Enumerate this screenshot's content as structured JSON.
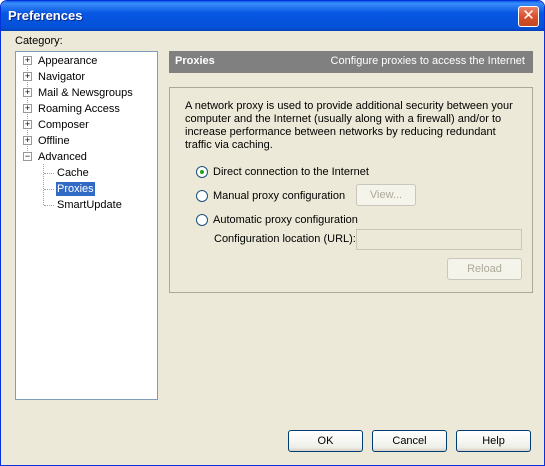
{
  "window": {
    "title": "Preferences"
  },
  "sidebar": {
    "label": "Category:",
    "items": [
      {
        "label": "Appearance",
        "expander": "+"
      },
      {
        "label": "Navigator",
        "expander": "+"
      },
      {
        "label": "Mail & Newsgroups",
        "expander": "+"
      },
      {
        "label": "Roaming Access",
        "expander": "+"
      },
      {
        "label": "Composer",
        "expander": "+"
      },
      {
        "label": "Offline",
        "expander": "+"
      },
      {
        "label": "Advanced",
        "expander": "−"
      },
      {
        "label": "Cache"
      },
      {
        "label": "Proxies",
        "selected": true
      },
      {
        "label": "SmartUpdate"
      }
    ]
  },
  "header": {
    "title": "Proxies",
    "description": "Configure proxies to access the Internet"
  },
  "panel": {
    "description": "A network proxy is used to provide additional security between your computer and the Internet (usually along with a firewall) and/or to increase performance between networks by reducing redundant traffic via caching.",
    "options": {
      "direct": {
        "label": "Direct connection to the Internet",
        "checked": true
      },
      "manual": {
        "label": "Manual proxy configuration",
        "checked": false
      },
      "auto": {
        "label": "Automatic proxy configuration",
        "checked": false
      }
    },
    "view_button": "View...",
    "url_label": "Configuration location (URL):",
    "url_value": "",
    "reload_button": "Reload"
  },
  "footer": {
    "ok": "OK",
    "cancel": "Cancel",
    "help": "Help"
  },
  "colors": {
    "titlebar": "#0551d8",
    "selection": "#316ac5",
    "header_bg": "#808080",
    "radio_dot": "#21a121"
  }
}
